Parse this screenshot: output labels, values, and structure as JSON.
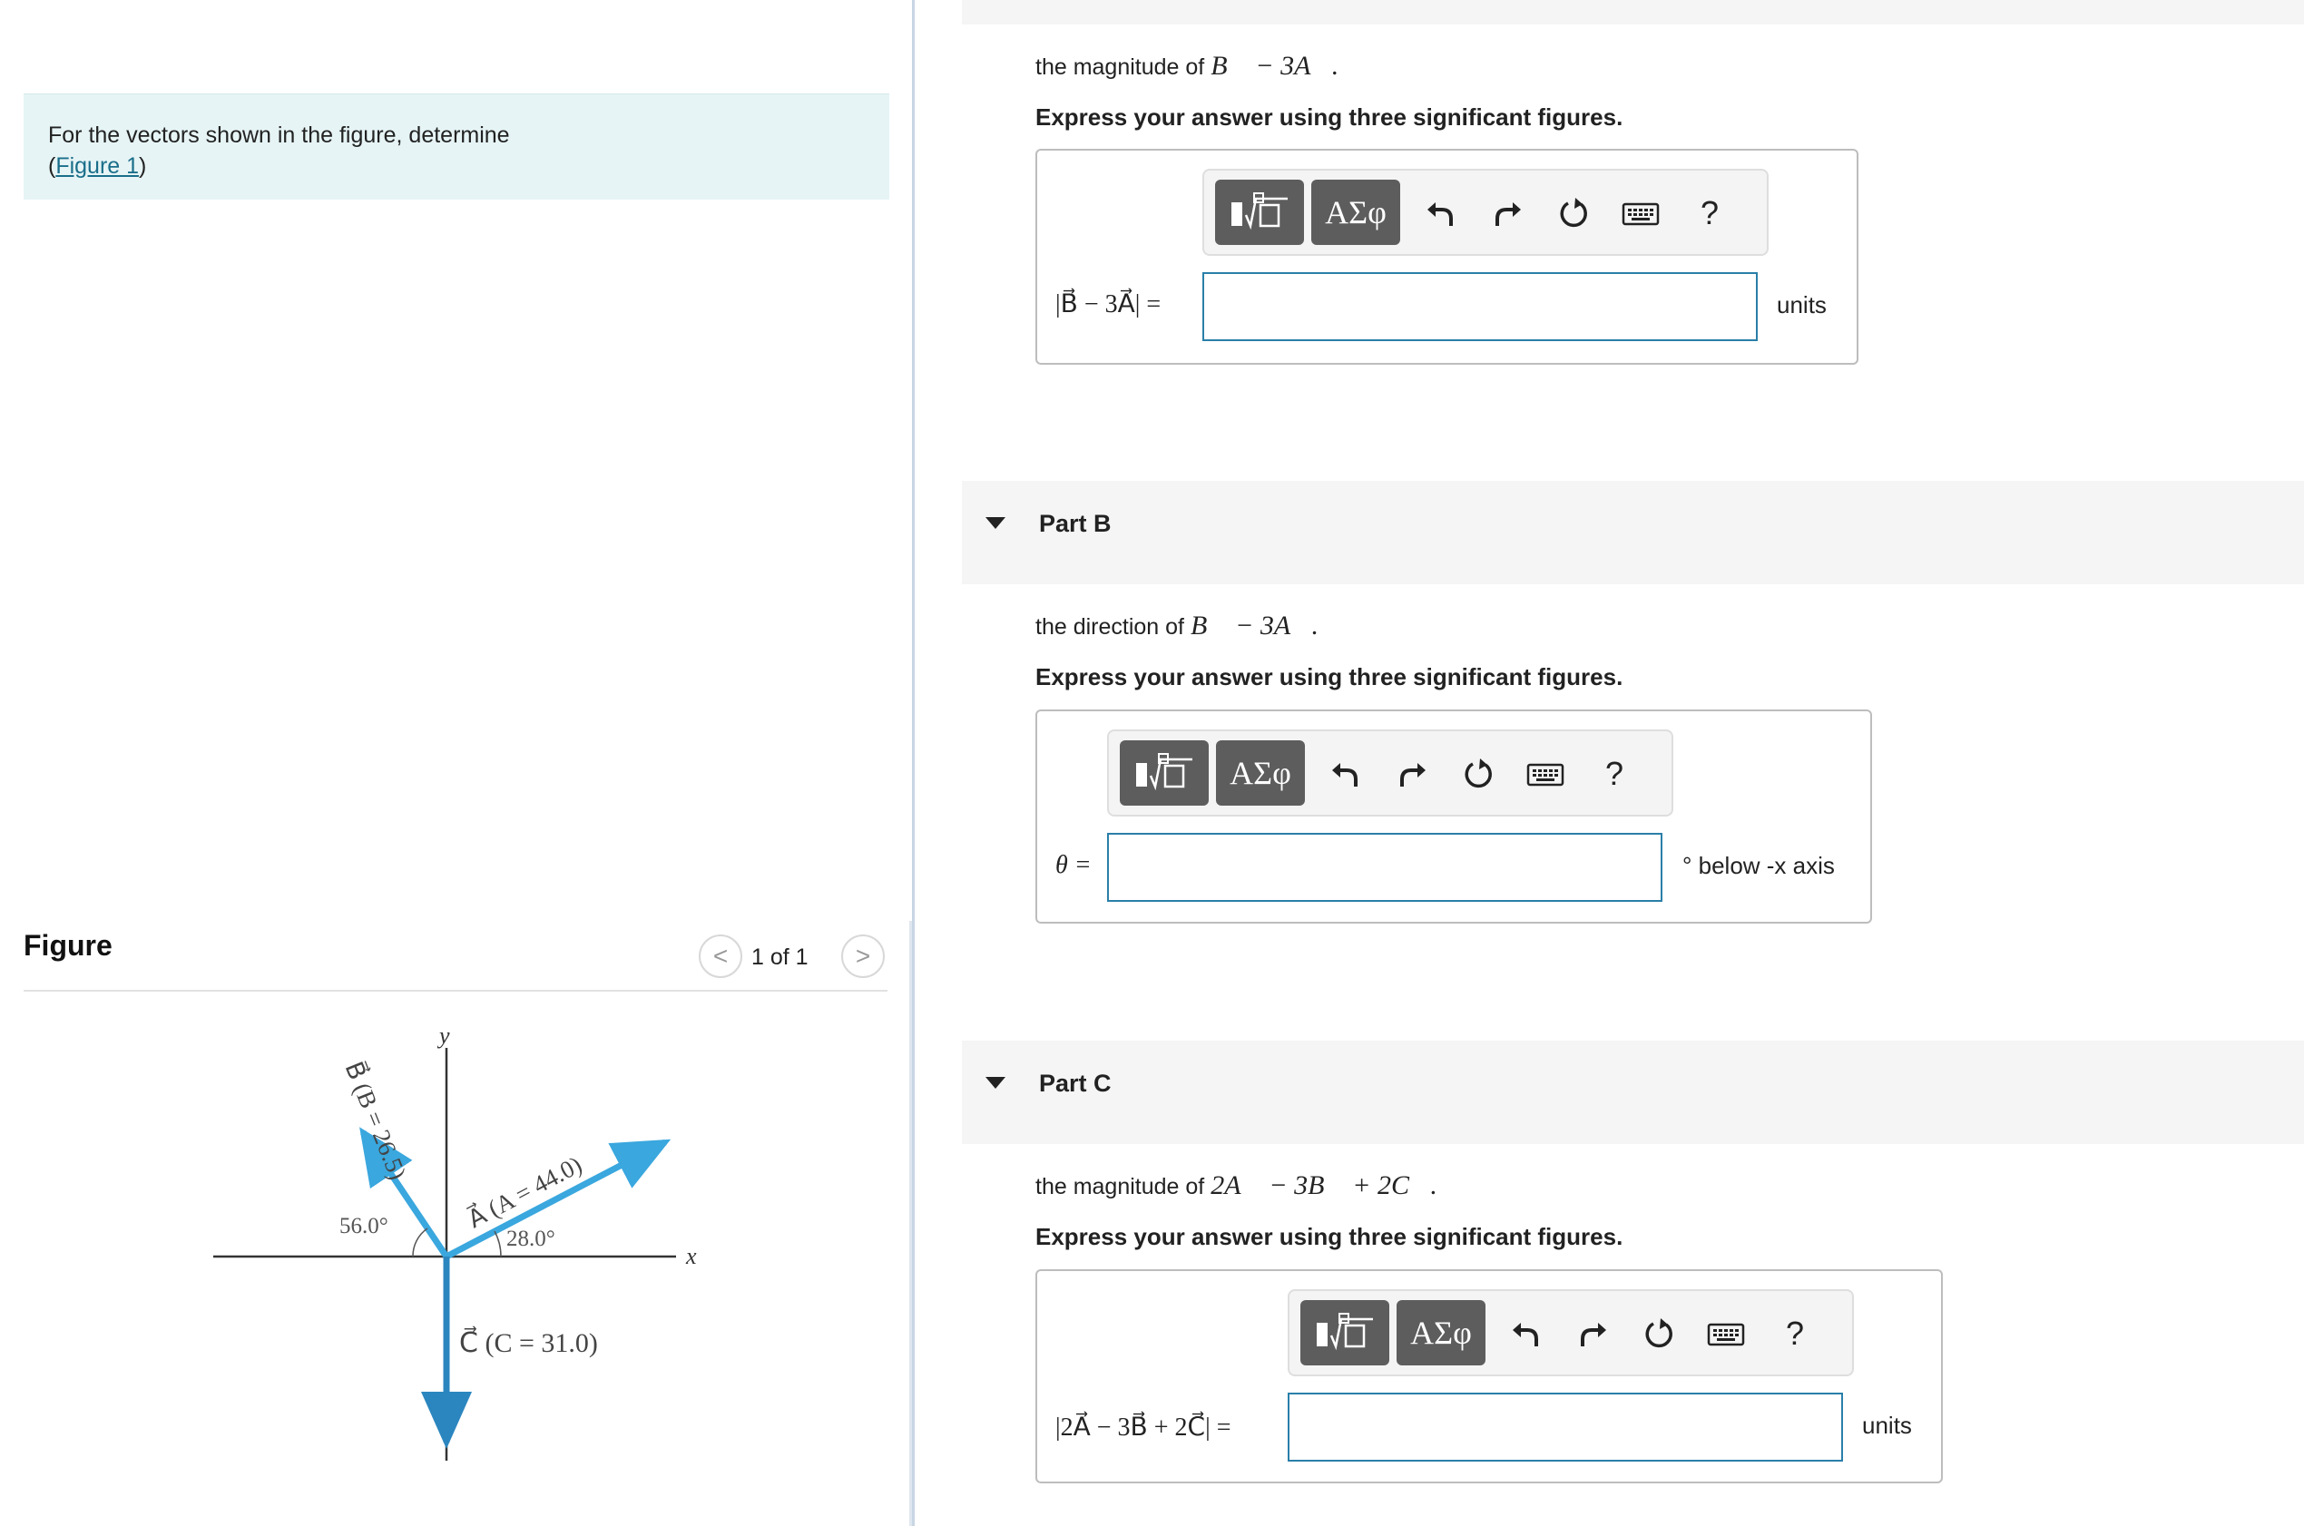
{
  "problem": {
    "text": "For the vectors shown in the figure, determine",
    "figure_link": "Figure 1"
  },
  "figure": {
    "heading": "Figure",
    "counter": "1 of 1",
    "prev_glyph": "<",
    "next_glyph": ">",
    "labels": {
      "y_axis": "y",
      "x_axis": "x",
      "vector_b": "B⃗ (B = 26.5)",
      "vector_a": "A⃗ (A = 44.0)",
      "vector_c": "C⃗ (C = 31.0)",
      "angle_b": "56.0°",
      "angle_a": "28.0°"
    },
    "angles": {
      "a_from_x_deg": 28.0,
      "b_from_neg_x_deg": 56.0
    },
    "colors": {
      "vector": "#3aa7de",
      "vector_c": "#2b86bf",
      "axis": "#333333"
    }
  },
  "partA": {
    "question_prefix": "the magnitude of ",
    "question_math": "B⃗ − 3A⃗.",
    "instruction": "Express your answer using three significant figures.",
    "input_label": "|B⃗ − 3A⃗| =",
    "input_value": "",
    "unit": "units"
  },
  "partB": {
    "title": "Part B",
    "question_prefix": "the direction of ",
    "question_math": "B⃗ − 3A⃗.",
    "instruction": "Express your answer using three significant figures.",
    "input_label": "θ =",
    "input_value": "",
    "unit": "° below -x axis"
  },
  "partC": {
    "title": "Part C",
    "question_prefix": "the magnitude of ",
    "question_math": "2A⃗ − 3B⃗ + 2C⃗.",
    "instruction": "Express your answer using three significant figures.",
    "input_label": "|2A⃗ − 3B⃗ + 2C⃗| =",
    "input_value": "",
    "unit": "units"
  },
  "toolbar": {
    "symbols_label": "ΑΣφ",
    "help_label": "?",
    "icons": [
      "templates-icon",
      "undo-icon",
      "redo-icon",
      "reset-icon",
      "keyboard-icon",
      "help-icon"
    ]
  },
  "colors": {
    "problem_bg": "#e6f4f5",
    "link": "#1a6e8a",
    "input_border": "#2a7fa8",
    "toolbar_button": "#5d5d5d"
  }
}
